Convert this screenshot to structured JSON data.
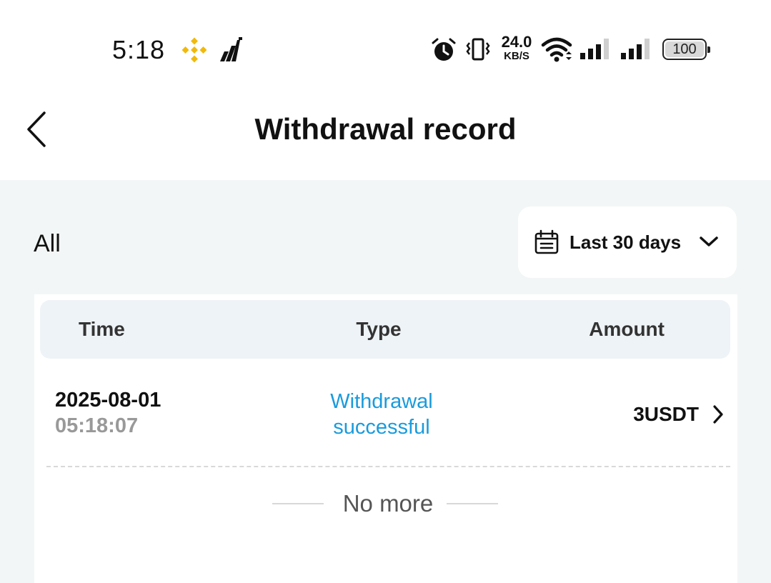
{
  "status_bar": {
    "time": "5:18",
    "net_speed_value": "24.0",
    "net_speed_unit": "KB/S",
    "battery": "100",
    "icons": [
      "binance-icon",
      "chart-app-icon",
      "alarm-icon",
      "vibrate-icon",
      "wifi-icon",
      "signal-icon",
      "signal-icon",
      "battery-icon"
    ]
  },
  "header": {
    "title": "Withdrawal record",
    "back_icon": "chevron-left-icon"
  },
  "filters": {
    "type_label": "All",
    "date_range_label": "Last 30 days",
    "date_icon": "calendar-icon",
    "dropdown_icon": "chevron-down-icon"
  },
  "table": {
    "columns": [
      "Time",
      "Type",
      "Amount"
    ],
    "rows": [
      {
        "date": "2025-08-01",
        "time": "05:18:07",
        "status_line1": "Withdrawal",
        "status_line2": "successful",
        "amount": "3USDT"
      }
    ],
    "end_text": "No more"
  },
  "colors": {
    "status_success": "#1a9bdc",
    "background": "#f3f6f6",
    "table_header": "#eef3f7",
    "binance_yellow": "#f0b90b"
  }
}
